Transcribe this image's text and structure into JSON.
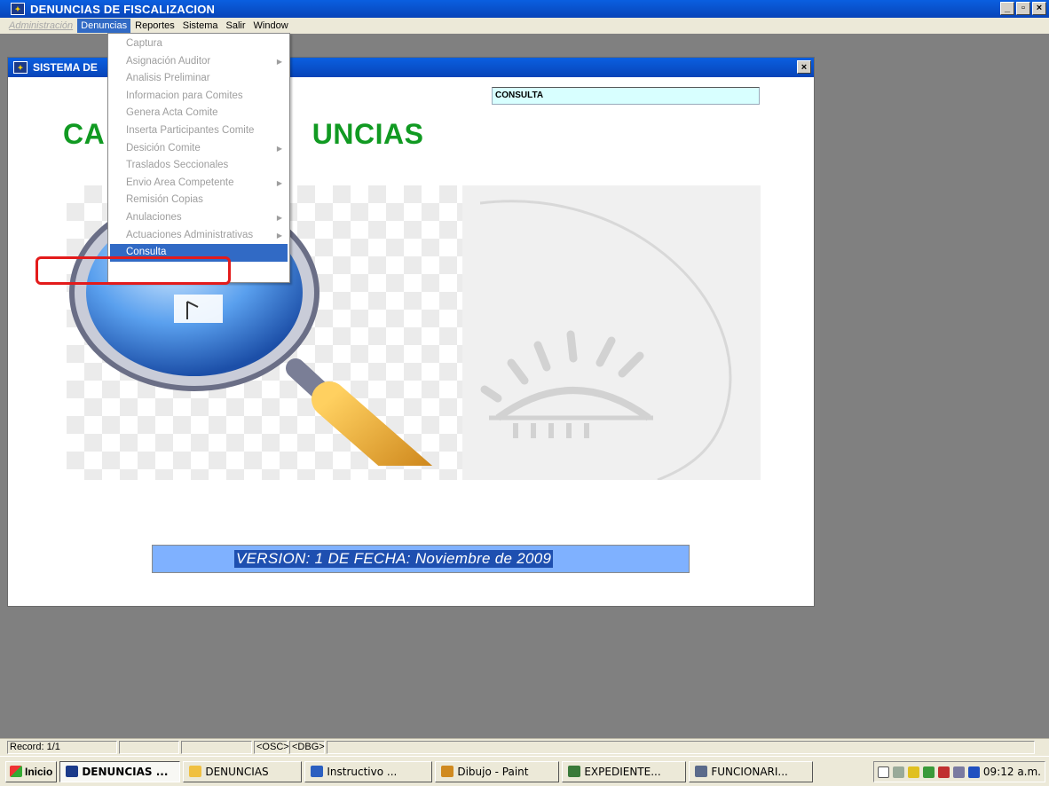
{
  "app": {
    "title": "DENUNCIAS DE FISCALIZACION",
    "window_buttons": {
      "minimize": "_",
      "maximize": "▫",
      "close": "×"
    }
  },
  "menubar": {
    "items": [
      {
        "label": "Administración",
        "state": "disabled"
      },
      {
        "label": "Denuncias",
        "state": "active"
      },
      {
        "label": "Reportes",
        "state": "normal"
      },
      {
        "label": "Sistema",
        "state": "normal"
      },
      {
        "label": "Salir",
        "state": "normal"
      },
      {
        "label": "Window",
        "state": "normal"
      }
    ]
  },
  "child_window": {
    "title": "SISTEMA DE",
    "close": "×",
    "consulta_label": "CONSULTA",
    "big_title": "CA                         UNCIAS",
    "version": "VERSION:  1 DE FECHA:  Noviembre de 2009"
  },
  "dropdown": {
    "items": [
      {
        "label": "Captura",
        "submenu": false
      },
      {
        "label": "Asignación Auditor",
        "submenu": true
      },
      {
        "label": "Analisis Preliminar",
        "submenu": false
      },
      {
        "label": "Informacion para Comites",
        "submenu": false
      },
      {
        "label": "Genera Acta Comite",
        "submenu": false
      },
      {
        "label": "Inserta Participantes Comite",
        "submenu": false
      },
      {
        "label": "Desición  Comite",
        "submenu": true
      },
      {
        "label": "Traslados Seccionales",
        "submenu": false
      },
      {
        "label": "Envio Area Competente",
        "submenu": true
      },
      {
        "label": "Remisión  Copias",
        "submenu": false
      },
      {
        "label": "Anulaciones",
        "submenu": true
      },
      {
        "label": "Actuaciones Administrativas",
        "submenu": true
      },
      {
        "label": "Consulta",
        "submenu": false,
        "selected": true
      }
    ],
    "arrow": "▶"
  },
  "statusbar": {
    "record": "Record: 1/1",
    "osc": "<OSC>",
    "dbg": "<DBG>"
  },
  "taskbar": {
    "start": "Inicio",
    "buttons": [
      {
        "label": "DENUNCIAS ...",
        "active": true,
        "icon_color": "#1b3a8a"
      },
      {
        "label": "DENUNCIAS",
        "active": false,
        "icon_color": "#f0c040"
      },
      {
        "label": "Instructivo ...",
        "active": false,
        "icon_color": "#2b5fc0"
      },
      {
        "label": "Dibujo - Paint",
        "active": false,
        "icon_color": "#d08a20"
      },
      {
        "label": "EXPEDIENTE...",
        "active": false,
        "icon_color": "#3a7a3a"
      },
      {
        "label": "FUNCIONARI...",
        "active": false,
        "icon_color": "#5a6a8a"
      }
    ],
    "tray_icons": [
      "help-icon",
      "network-icon",
      "messenger-icon",
      "security-icon",
      "shield-icon",
      "antivirus-icon",
      "vpn-icon"
    ],
    "clock": "09:12 a.m."
  }
}
